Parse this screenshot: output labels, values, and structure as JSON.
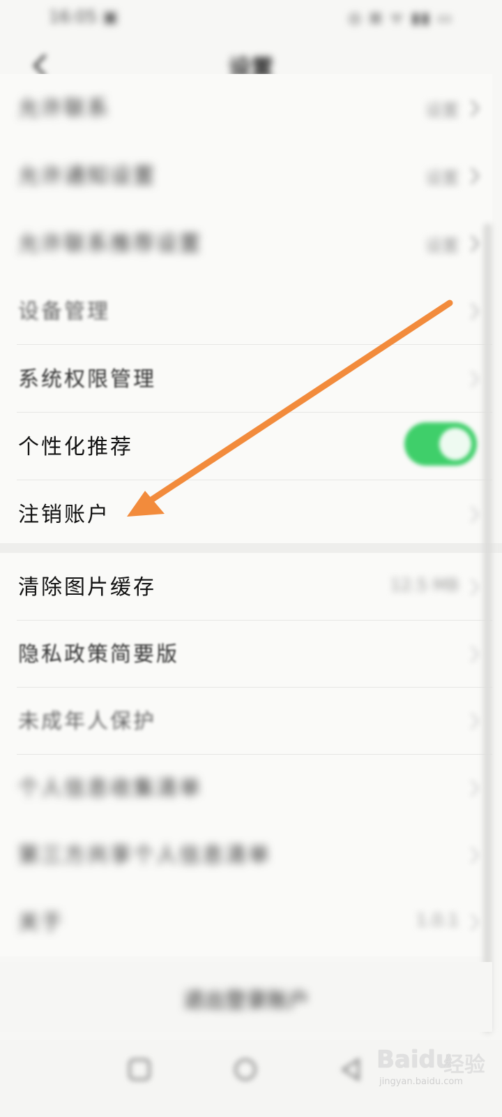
{
  "status_bar": {
    "time": "16:05 ▣",
    "icons": "◎ ⊠ ᯤ ▮▮ ▭"
  },
  "header": {
    "title": "设置",
    "back_icon": "chevron-left-icon"
  },
  "section_one": {
    "rows": [
      {
        "label": "允许联系",
        "value": "设置"
      },
      {
        "label": "允许通知设置",
        "value": "设置"
      },
      {
        "label": "允许联系推荐设置",
        "value": "设置"
      },
      {
        "label": "设备管理"
      },
      {
        "label": "系统权限管理"
      },
      {
        "label": "个性化推荐",
        "toggle_on": true
      },
      {
        "label": "注销账户"
      }
    ]
  },
  "section_two": {
    "rows": [
      {
        "label": "清除图片缓存",
        "value": "12.5 MB"
      },
      {
        "label": "隐私政策简要版"
      },
      {
        "label": "未成年人保护"
      },
      {
        "label": "个人信息收集清单"
      },
      {
        "label": "第三方共享个人信息清单"
      },
      {
        "label": "关于",
        "value": "1.0.1"
      }
    ]
  },
  "logout": {
    "label": "退出登录账户"
  },
  "watermark": {
    "logo": "Baidu",
    "suffix": "经验",
    "url": "jingyan.baidu.com"
  },
  "colors": {
    "toggle_on": "#3fcf6a",
    "annotation_arrow": "#f28b3c",
    "background": "#f7f7f5"
  }
}
